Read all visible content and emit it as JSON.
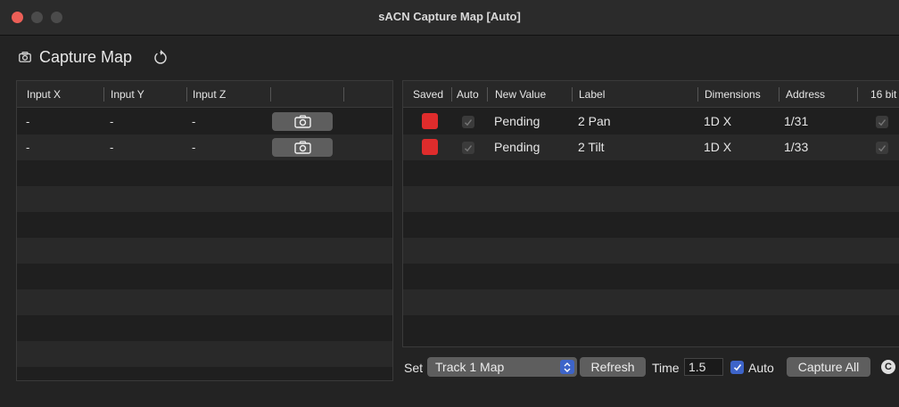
{
  "window": {
    "title": "sACN Capture Map [Auto]"
  },
  "toolbar": {
    "title": "Capture Map",
    "camera_icon": "camera-icon",
    "reset_icon": "reset-icon"
  },
  "input_table": {
    "columns": [
      "Input X",
      "Input Y",
      "Input Z",
      ""
    ],
    "rows": [
      {
        "x": "-",
        "y": "-",
        "z": "-"
      },
      {
        "x": "-",
        "y": "-",
        "z": "-"
      }
    ],
    "capture_icon": "camera-icon"
  },
  "params_table": {
    "columns": [
      "Saved",
      "Auto",
      "New Value",
      "Label",
      "Dimensions",
      "Address",
      "16 bit"
    ],
    "rows": [
      {
        "saved": true,
        "auto": true,
        "new_value": "Pending",
        "label": "2 Pan",
        "dimensions": "1D X",
        "address": "1/31",
        "sixteen_bit": true
      },
      {
        "saved": true,
        "auto": true,
        "new_value": "Pending",
        "label": "2 Tilt",
        "dimensions": "1D X",
        "address": "1/33",
        "sixteen_bit": true
      }
    ]
  },
  "bottom_bar": {
    "set_label": "Set",
    "set_value": "Track 1 Map",
    "refresh_label": "Refresh",
    "time_label": "Time",
    "time_value": "1.5",
    "auto_label": "Auto",
    "auto_checked": true,
    "capture_all_label": "Capture All",
    "c_badge": "C"
  },
  "colors": {
    "saved_red": "#df2c2c",
    "accent_blue": "#3d64c9",
    "close_red": "#ec5f57"
  }
}
